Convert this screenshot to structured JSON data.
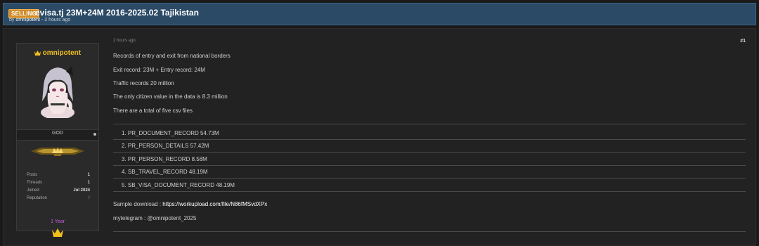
{
  "thread": {
    "tag": "SELLING",
    "title": "evisa.tj 23M+24M 2016-2025.02 Tajikistan",
    "meta_prefix": "by",
    "author": "omnipotent",
    "meta_time": "- 2 hours ago"
  },
  "user": {
    "name": "omnipotent",
    "rank": "GOD",
    "stats": [
      {
        "label": "Posts",
        "value": "1"
      },
      {
        "label": "Threads",
        "value": "1"
      },
      {
        "label": "Joined",
        "value": "Jul 2024"
      },
      {
        "label": "Reputation",
        "value": "0"
      }
    ],
    "year_badge": "1 Year"
  },
  "post": {
    "date": "2 hours ago",
    "number": "#1",
    "lines": [
      "Records of entry and exit from national borders",
      "Exit record: 23M + Entry record: 24M",
      "Traffic records 20 million",
      "The only citizen value in the data is 8.3 million",
      "There are a total of five csv files"
    ],
    "files": [
      "1.  PR_DOCUMENT_RECORD 54.73M",
      "2.  PR_PERSON_DETAILS 57.42M",
      "3.  PR_PERSON_RECORD 8.58M",
      "4.  SB_TRAVEL_RECORD 48.19M",
      "5.  SB_VISA_DOCUMENT_RECORD 48.19M"
    ],
    "sample_label": "Sample download : ",
    "sample_link": "https://workupload.com/file/N86fMSvdXPx",
    "telegram": "mytelegram : @omnipotent_2025"
  },
  "colors": {
    "header_bg": "#2b4a66",
    "tag_bg": "#d08d2a",
    "username": "#f0c020",
    "year_badge": "#c060e0"
  },
  "icons": [
    "crown-icon",
    "online-status-icon",
    "rank-banner-icon"
  ]
}
